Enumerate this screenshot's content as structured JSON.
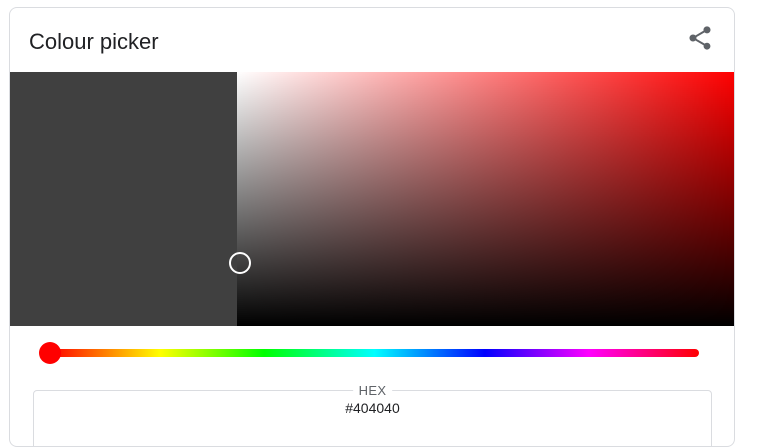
{
  "header": {
    "title": "Colour picker",
    "share_icon": "share-icon"
  },
  "colors": {
    "selected": "#404040",
    "hue": "#ff0000",
    "handle_border": "#ffffff"
  },
  "picker": {
    "hue_degrees": 0,
    "saturation": 0,
    "value": 0.25
  },
  "hex_field": {
    "label": "HEX",
    "value": "#404040"
  }
}
